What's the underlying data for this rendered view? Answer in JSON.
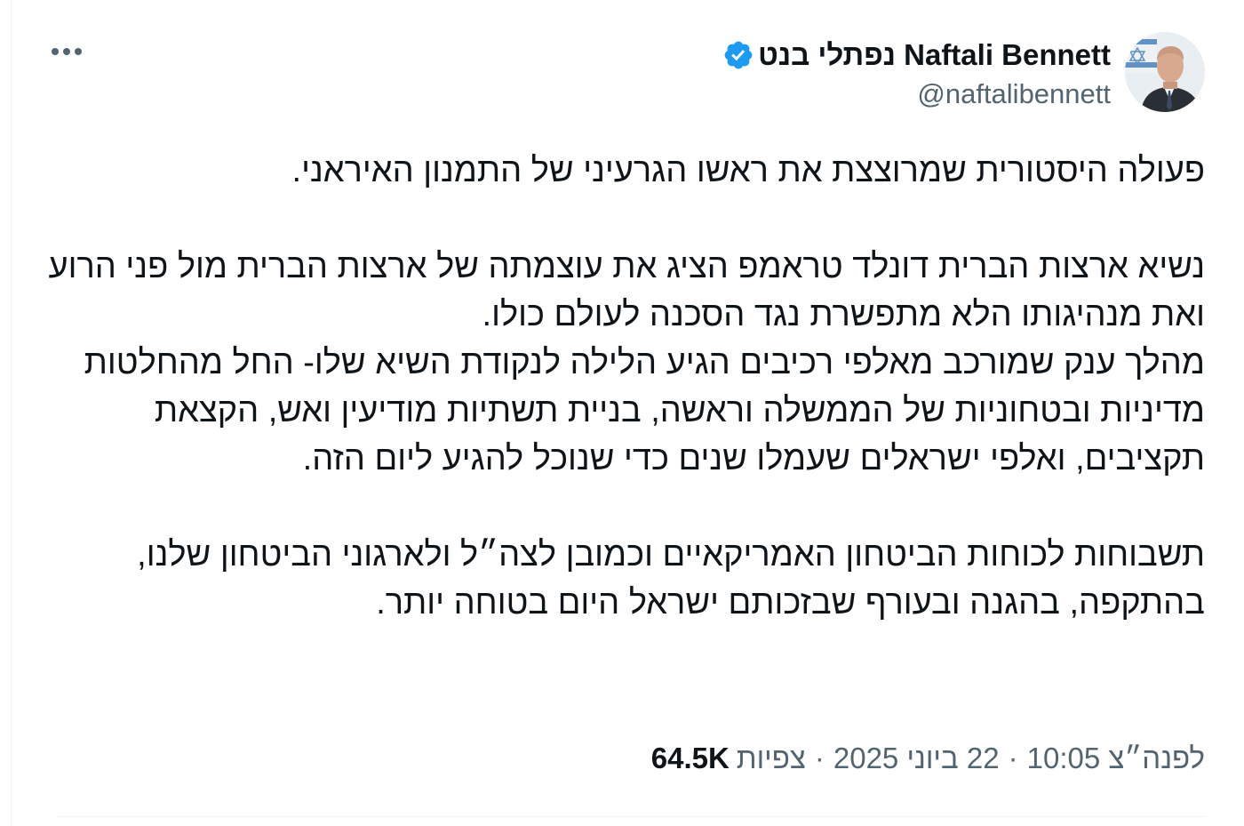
{
  "author": {
    "display_name": "נפתלי בנט Naftali Bennett",
    "handle": "@naftalibennett",
    "verified": true
  },
  "more_icon": "ellipsis-icon",
  "tweet": {
    "paragraphs": [
      "פעולה היסטורית שמרוצצת את ראשו הגרעיני של התמנון האיראני.",
      "",
      "נשיא ארצות הברית דונלד טראמפ הציג את עוצמתה של ארצות הברית מול פני הרוע ואת מנהיגותו הלא מתפשרת נגד הסכנה לעולם כולו.",
      "מהלך ענק שמורכב מאלפי רכיבים הגיע הלילה לנקודת השיא שלו- החל מהחלטות מדיניות ובטחוניות של הממשלה וראשה, בניית תשתיות מודיעין ואש, הקצאת תקציבים, ואלפי ישראלים שעמלו שנים כדי שנוכל להגיע ליום הזה.",
      "",
      "תשבוחות לכוחות הביטחון האמריקאיים וכמובן לצה״ל ולארגוני הביטחון שלנו, בהתקפה, בהגנה ובעורף שבזכותם ישראל היום בטוחה יותר."
    ]
  },
  "meta": {
    "time": "לפנה״צ 10:05",
    "date": "22 ביוני 2025",
    "views_count": "64.5K",
    "views_label": "צפיות",
    "separator": "·"
  },
  "colors": {
    "verified_blue": "#1d9bf0",
    "text_primary": "#0f1419",
    "text_secondary": "#536471"
  }
}
